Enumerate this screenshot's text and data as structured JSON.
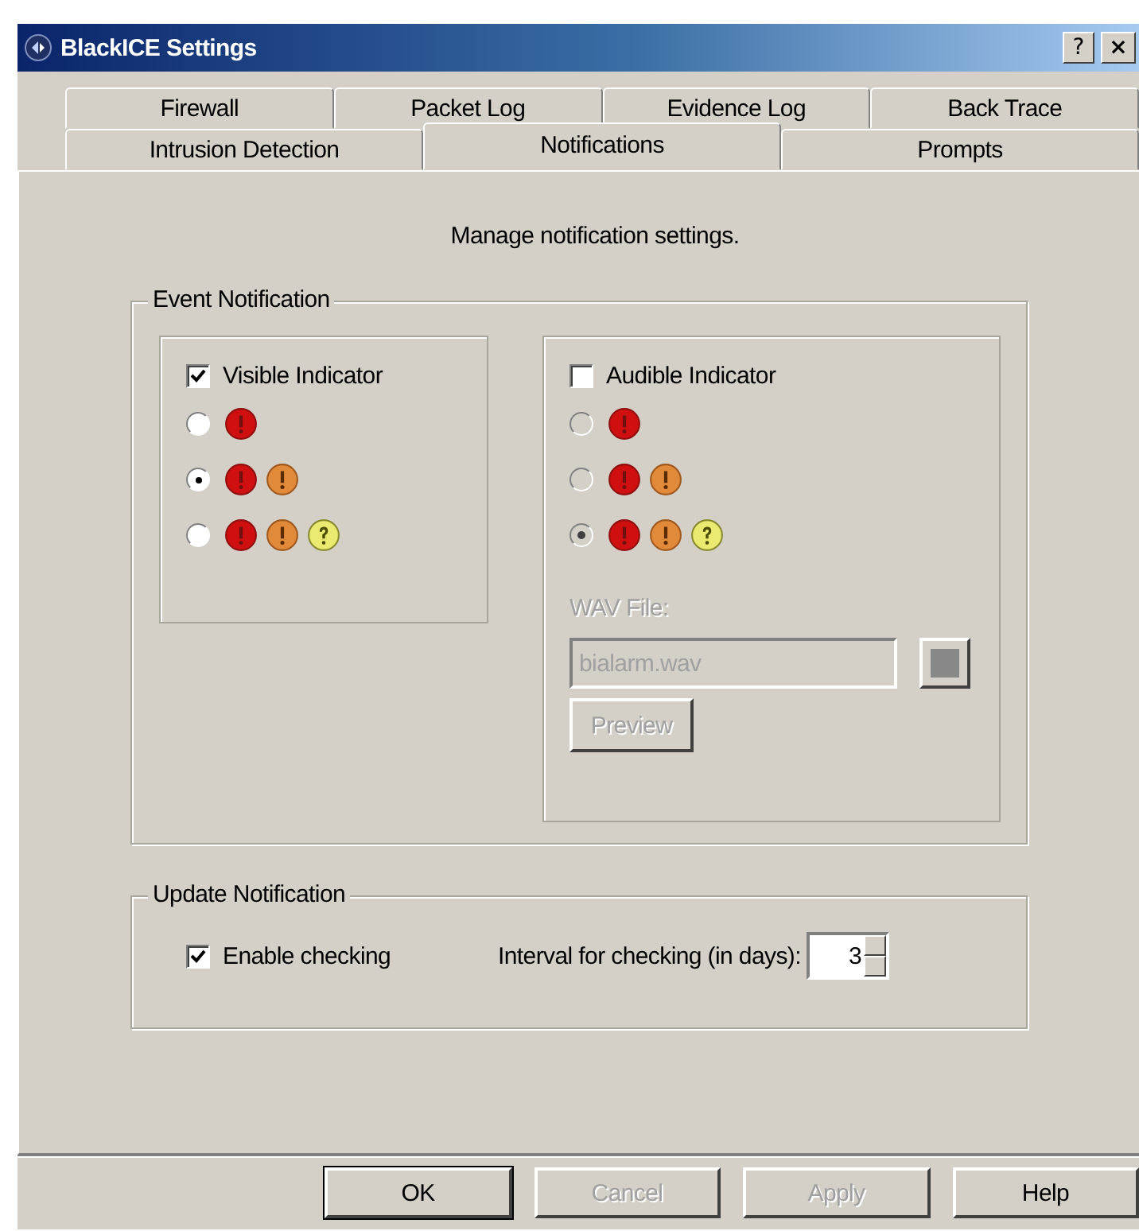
{
  "window": {
    "title": "BlackICE Settings",
    "title_buttons": [
      {
        "kind": "help",
        "label": "?"
      },
      {
        "kind": "close",
        "label": "×"
      }
    ]
  },
  "tab_rows": [
    [
      {
        "label": "Firewall",
        "selected": false
      },
      {
        "label": "Packet Log",
        "selected": false
      },
      {
        "label": "Evidence Log",
        "selected": false
      },
      {
        "label": "Back Trace",
        "selected": false
      }
    ],
    [
      {
        "label": "Intrusion Detection",
        "selected": false
      },
      {
        "label": "Notifications",
        "selected": true
      },
      {
        "label": "Prompts",
        "selected": false
      }
    ]
  ],
  "heading": "Manage notification settings.",
  "event_notification": {
    "title": "Event Notification",
    "panels": [
      {
        "kind": "visible",
        "label": "Visible Indicator",
        "checked": true,
        "options": [
          {
            "severities": [
              {
                "kind": "high"
              }
            ],
            "selected": false
          },
          {
            "severities": [
              {
                "kind": "high"
              },
              {
                "kind": "medium"
              }
            ],
            "selected": true
          },
          {
            "severities": [
              {
                "kind": "high"
              },
              {
                "kind": "medium"
              },
              {
                "kind": "low"
              }
            ],
            "selected": false
          }
        ]
      },
      {
        "kind": "audible",
        "label": "Audible Indicator",
        "checked": false,
        "options": [
          {
            "severities": [
              {
                "kind": "high"
              }
            ],
            "selected": false
          },
          {
            "severities": [
              {
                "kind": "high"
              },
              {
                "kind": "medium"
              }
            ],
            "selected": false
          },
          {
            "severities": [
              {
                "kind": "high"
              },
              {
                "kind": "medium"
              },
              {
                "kind": "low"
              }
            ],
            "selected": true
          }
        ],
        "wav_label": "WAV File:",
        "wav_value": "bialarm.wav",
        "preview": "Preview"
      }
    ]
  },
  "update_notification": {
    "title": "Update Notification",
    "enable": {
      "label": "Enable checking",
      "checked": true
    },
    "interval_label": "Interval for checking (in days):",
    "interval_value": "3"
  },
  "buttons": [
    {
      "label": "OK",
      "disabled": false,
      "default": true
    },
    {
      "label": "Cancel",
      "disabled": true,
      "default": false
    },
    {
      "label": "Apply",
      "disabled": true,
      "default": false
    },
    {
      "label": "Help",
      "disabled": false,
      "default": false
    }
  ]
}
